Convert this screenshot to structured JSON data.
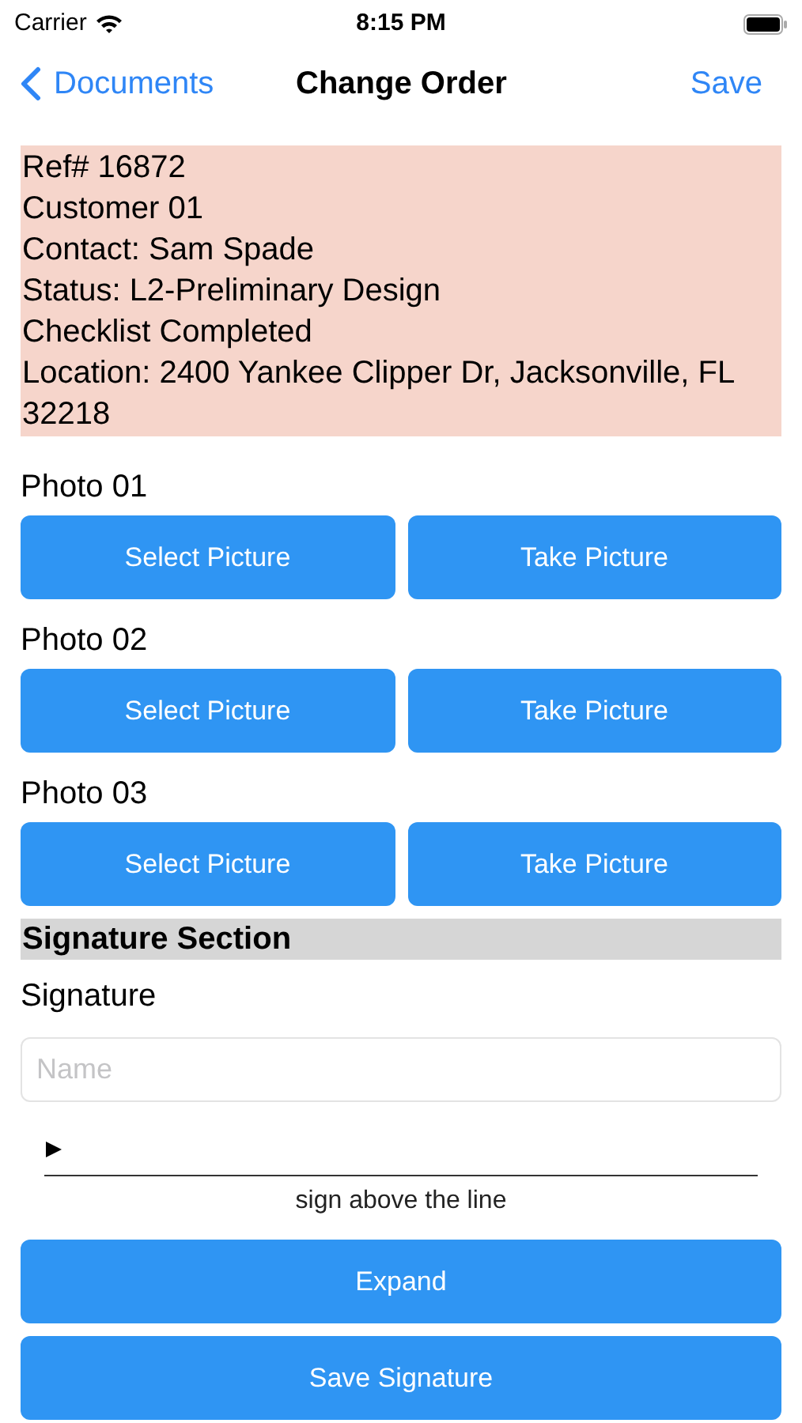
{
  "status_bar": {
    "carrier": "Carrier",
    "time": "8:15 PM"
  },
  "nav": {
    "back": "Documents",
    "title": "Change Order",
    "action": "Save"
  },
  "info_lines": [
    "Ref# 16872",
    "Customer 01",
    "Contact:  Sam Spade",
    "Status: L2-Preliminary Design",
    "Checklist Completed",
    "Location: 2400 Yankee Clipper Dr, Jacksonville, FL 32218"
  ],
  "photos": [
    {
      "label": "Photo 01",
      "buttons": [
        "Select Picture",
        "Take Picture"
      ]
    },
    {
      "label": "Photo 02",
      "buttons": [
        "Select Picture",
        "Take Picture"
      ]
    },
    {
      "label": "Photo 03",
      "buttons": [
        "Select Picture",
        "Take Picture"
      ]
    }
  ],
  "section_header": "Signature Section",
  "signature": {
    "label": "Signature",
    "name_placeholder": "Name",
    "caption": "sign above the line"
  },
  "buttons": [
    "Expand",
    "Save Signature"
  ]
}
